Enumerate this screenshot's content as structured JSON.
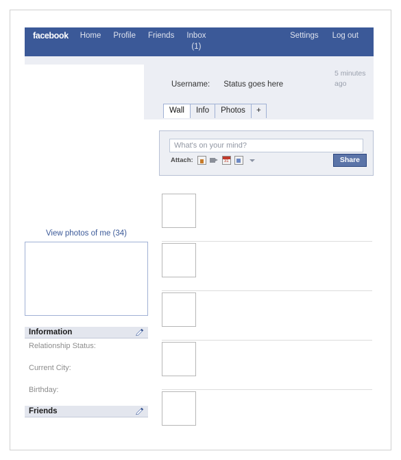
{
  "navbar": {
    "brand": "facebook",
    "links": [
      {
        "label": "Home",
        "sub": ""
      },
      {
        "label": "Profile",
        "sub": ""
      },
      {
        "label": "Friends",
        "sub": ""
      },
      {
        "label": "Inbox",
        "sub": "(1)"
      }
    ],
    "right_links": [
      {
        "label": "Settings"
      },
      {
        "label": "Log out"
      }
    ],
    "bg_color": "#3b5998",
    "text_color": "#dfe3ee"
  },
  "profile": {
    "username_label": "Username:",
    "status_text": "Status goes here",
    "timestamp": "5 minutes ago"
  },
  "tabs": [
    {
      "label": "Wall",
      "active": true
    },
    {
      "label": "Info",
      "active": false
    },
    {
      "label": "Photos",
      "active": false
    },
    {
      "label": "+",
      "active": false
    }
  ],
  "composer": {
    "placeholder": "What's on your mind?",
    "value": "",
    "attach_label": "Attach:",
    "attach_icons": [
      "photo-icon",
      "video-icon",
      "event-icon",
      "link-icon"
    ],
    "more_icon": "chevron-down-icon",
    "share_label": "Share",
    "share_color": "#5b74a8"
  },
  "feed": {
    "items": [
      {
        "thumb": "",
        "text": ""
      },
      {
        "thumb": "",
        "text": ""
      },
      {
        "thumb": "",
        "text": ""
      },
      {
        "thumb": "",
        "text": ""
      },
      {
        "thumb": "",
        "text": ""
      }
    ]
  },
  "sidebar": {
    "view_photos_label": "View photos of me (34)",
    "view_photos_color": "#3b5998",
    "information": {
      "title": "Information",
      "edit_icon": "pencil-icon",
      "rows": [
        "Relationship Status:",
        "Current City:",
        "Birthday:"
      ]
    },
    "friends": {
      "title": "Friends",
      "edit_icon": "pencil-icon"
    }
  }
}
